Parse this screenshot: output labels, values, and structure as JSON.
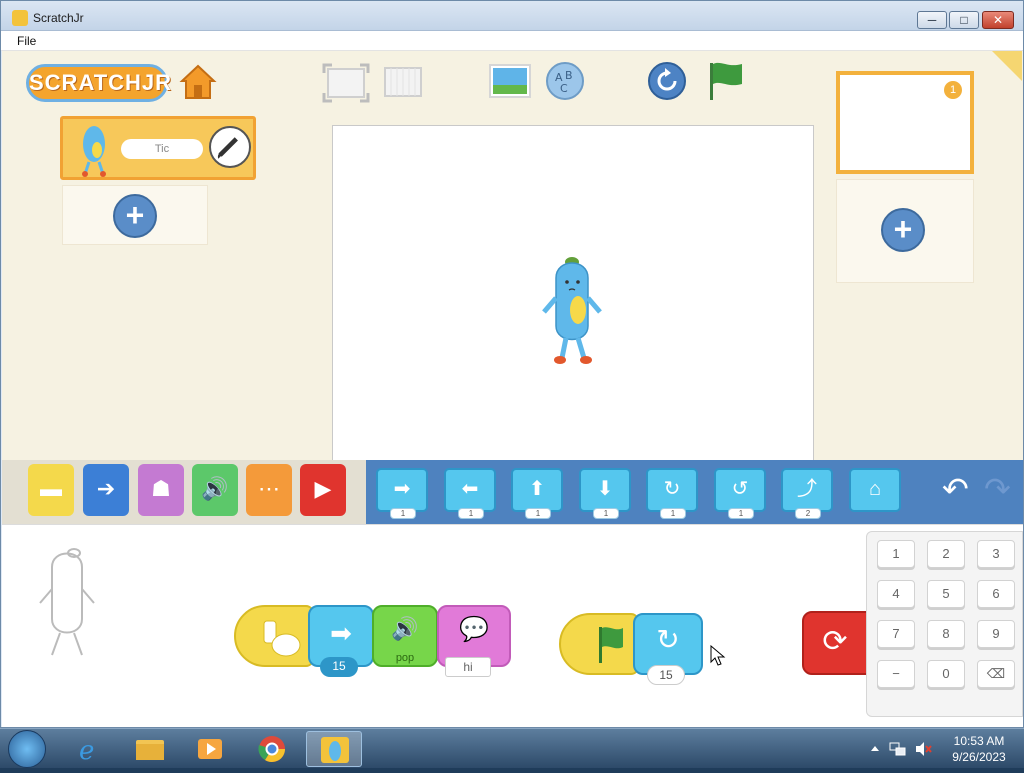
{
  "window": {
    "title": "ScratchJr",
    "minimize_label": "─",
    "maximize_label": "□",
    "close_label": "✕"
  },
  "menubar": {
    "file_label": "File"
  },
  "app": {
    "logo_text": "SCRATCHJR",
    "sprite": {
      "name": "Tic"
    },
    "page": {
      "number": "1"
    },
    "plus_label": "+"
  },
  "categories": [
    {
      "name": "triggering",
      "color": "#f4d94b",
      "glyph": "▬"
    },
    {
      "name": "motion",
      "color": "#3c7fd6",
      "glyph": "➔"
    },
    {
      "name": "looks",
      "color": "#c47ad2",
      "glyph": "☗"
    },
    {
      "name": "sound",
      "color": "#5cc86a",
      "glyph": "🔊"
    },
    {
      "name": "control",
      "color": "#f49a3a",
      "glyph": "⋯"
    },
    {
      "name": "end",
      "color": "#e0342e",
      "glyph": "▶"
    }
  ],
  "motion_blocks": [
    {
      "name": "move-right",
      "glyph": "➡",
      "value": "1"
    },
    {
      "name": "move-left",
      "glyph": "⬅",
      "value": "1"
    },
    {
      "name": "move-up",
      "glyph": "⬆",
      "value": "1"
    },
    {
      "name": "move-down",
      "glyph": "⬇",
      "value": "1"
    },
    {
      "name": "turn-right",
      "glyph": "↻",
      "value": "1"
    },
    {
      "name": "turn-left",
      "glyph": "↺",
      "value": "1"
    },
    {
      "name": "hop",
      "glyph": "⤴",
      "value": "2"
    },
    {
      "name": "go-home",
      "glyph": "⌂",
      "value": ""
    }
  ],
  "scripts": {
    "script1": {
      "move_value": "15",
      "sound_label": "pop",
      "say_text": "hi"
    },
    "script2": {
      "turn_value": "15"
    }
  },
  "keypad": {
    "keys": [
      "1",
      "2",
      "3",
      "4",
      "5",
      "6",
      "7",
      "8",
      "9",
      "−",
      "0",
      "⌫"
    ]
  },
  "taskbar": {
    "time": "10:53 AM",
    "date": "9/26/2023"
  }
}
